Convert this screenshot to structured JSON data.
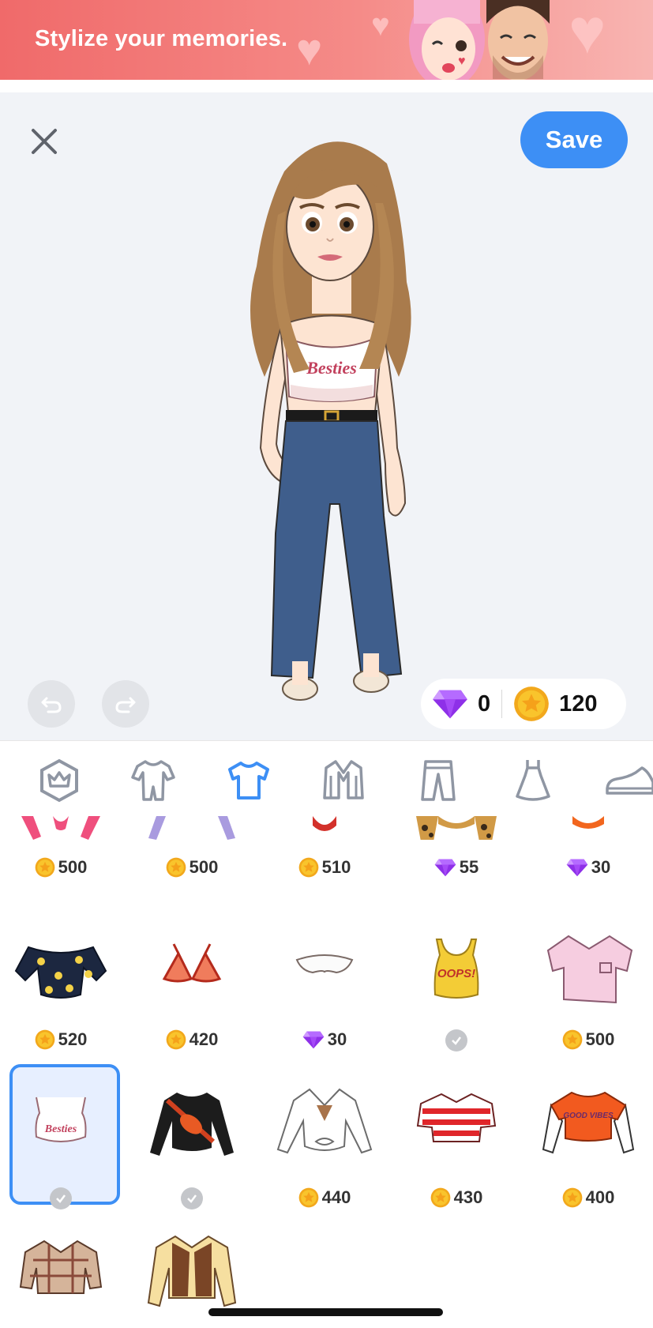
{
  "banner": {
    "text": "Stylize your memories."
  },
  "toolbar": {
    "save_label": "Save"
  },
  "wallet": {
    "gems": "0",
    "coins": "120"
  },
  "avatar": {
    "shirt_text": "Besties"
  },
  "tabs": [
    {
      "name": "premium",
      "icon": "crown-icon",
      "active": false
    },
    {
      "name": "onesie",
      "icon": "onesie-icon",
      "active": false
    },
    {
      "name": "tops",
      "icon": "tshirt-icon",
      "active": true
    },
    {
      "name": "outerwear",
      "icon": "jacket-icon",
      "active": false
    },
    {
      "name": "bottoms",
      "icon": "pants-icon",
      "active": false
    },
    {
      "name": "dresses",
      "icon": "dress-icon",
      "active": false
    },
    {
      "name": "shoes",
      "icon": "sneaker-icon",
      "active": false
    }
  ],
  "items": {
    "row1": [
      {
        "currency": "coin",
        "price": "500"
      },
      {
        "currency": "coin",
        "price": "500"
      },
      {
        "currency": "coin",
        "price": "510"
      },
      {
        "currency": "gem",
        "price": "55"
      },
      {
        "currency": "gem",
        "price": "30"
      }
    ],
    "row2": [
      {
        "currency": "coin",
        "price": "520",
        "name": "navy-lemon-tie-top"
      },
      {
        "currency": "coin",
        "price": "420",
        "name": "orange-bikini-top"
      },
      {
        "currency": "gem",
        "price": "30",
        "name": "white-bandeau"
      },
      {
        "currency": "owned",
        "price": "",
        "name": "oops-tank",
        "label": "OOPS!"
      },
      {
        "currency": "coin",
        "price": "500",
        "name": "pink-pajama-shirt"
      }
    ],
    "row3": [
      {
        "currency": "owned",
        "price": "",
        "name": "besties-crop-top",
        "label": "Besties",
        "selected": true
      },
      {
        "currency": "owned",
        "price": "",
        "name": "black-top-fanny-pack"
      },
      {
        "currency": "coin",
        "price": "440",
        "name": "white-tie-shirt"
      },
      {
        "currency": "coin",
        "price": "430",
        "name": "red-striped-polo"
      },
      {
        "currency": "coin",
        "price": "400",
        "name": "good-vibes-tee",
        "label": "GOOD VIBES"
      }
    ],
    "row4": [
      {
        "name": "plaid-shirt"
      },
      {
        "name": "brown-vest-outfit"
      }
    ]
  },
  "colors": {
    "accent": "#3d8ff5",
    "coin": "#f7c028",
    "gem": "#9b3ef0",
    "stage_bg": "#f1f3f7"
  }
}
